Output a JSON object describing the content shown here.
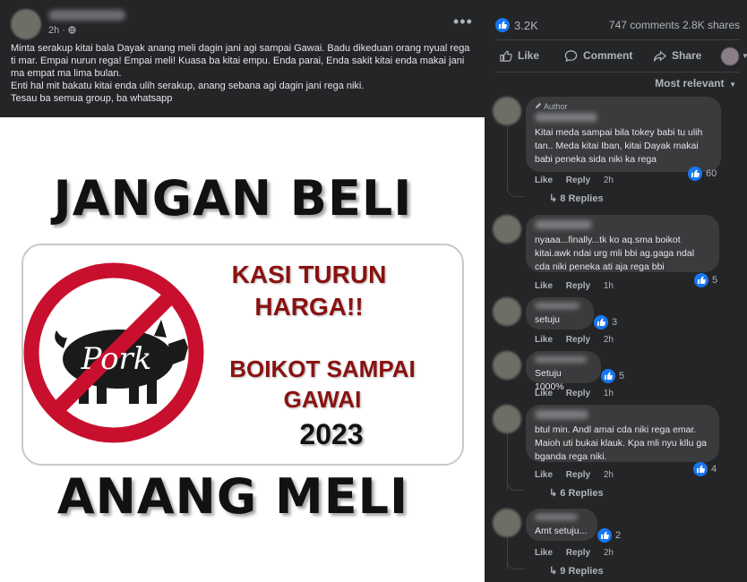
{
  "post": {
    "time": "2h ·",
    "caption": [
      "Minta serakup kitai bala Dayak anang meli dagin jani agi sampai Gawai. Badu dikeduan orang nyual rega ti mar. Empai nurun rega! Empai meli! Kuasa ba kitai empu. Enda parai, Enda sakit kitai enda makai jani ma empat ma lima bulan.",
      "Enti hal mit bakatu kitai enda ulih serakup, anang sebana agi dagin jani rega niki.",
      "Tesau ba semua group, ba whatsapp"
    ],
    "image": {
      "title_top": "JANGAN BELI",
      "title_bottom": "ANANG MELI",
      "pork_label": "Pork",
      "line1": "KASI TURUN",
      "line2": "HARGA!!",
      "line3": "BOIKOT SAMPAI",
      "line4": "GAWAI",
      "year": "2023"
    }
  },
  "stats": {
    "likes": "3.2K",
    "comments_shares": "747 comments  2.8K shares"
  },
  "actions": {
    "like": "Like",
    "comment": "Comment",
    "share": "Share"
  },
  "sort_label": "Most relevant",
  "comments": [
    {
      "author_badge": "Author",
      "text": "Kitai meda sampai bila tokey babi tu ulih tan.. Meda kitai Iban, kitai Dayak makai babi peneka sida niki ka rega",
      "reacts": "60",
      "like": "Like",
      "reply": "Reply",
      "time": "2h",
      "replies": "8 Replies"
    },
    {
      "text": "nyaaa...finally...tk ko aq.sma boikot kitai.awk ndai urg mli bbi ag.gaga ndal cda niki peneka ati aja rega bbi",
      "reacts": "5",
      "like": "Like",
      "reply": "Reply",
      "time": "1h"
    },
    {
      "text": "setuju",
      "reacts": "3",
      "like": "Like",
      "reply": "Reply",
      "time": "2h"
    },
    {
      "text": "Setuju 1000%",
      "reacts": "5",
      "like": "Like",
      "reply": "Reply",
      "time": "1h"
    },
    {
      "text": "btul min. Andl amai cda niki rega emar. Maioh uti bukai klauk. Kpa mli nyu kllu ga bganda rega niki.",
      "reacts": "4",
      "like": "Like",
      "reply": "Reply",
      "time": "2h",
      "replies": "6 Replies"
    },
    {
      "text": "Amt setuju...",
      "reacts": "2",
      "like": "Like",
      "reply": "Reply",
      "time": "2h",
      "replies": "9 Replies"
    }
  ],
  "colors": {
    "accent": "#1877f2",
    "bg": "#242526",
    "bubble": "#3a3b3c",
    "sign_red": "#c8102e"
  }
}
